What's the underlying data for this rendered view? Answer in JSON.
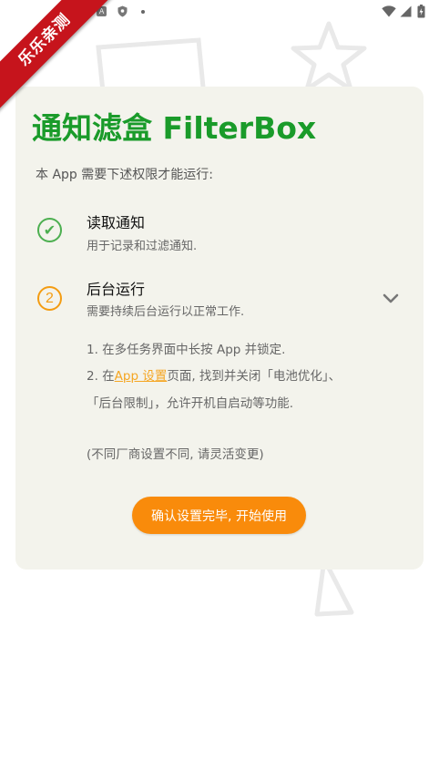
{
  "status_bar": {
    "left_icons": [
      "app-notification-icon",
      "a-notification-icon",
      "shield-notification-icon",
      "dot-notification-icon"
    ],
    "right_icons": [
      "wifi-icon",
      "signal-icon",
      "battery-icon"
    ],
    "box_letter": "A"
  },
  "ribbon": {
    "label": "乐乐亲测"
  },
  "card": {
    "title": "通知滤盒 FilterBox",
    "intro": "本 App 需要下述权限才能运行:",
    "permissions": [
      {
        "status": "granted",
        "icon": "check-icon",
        "icon_glyph": "✔",
        "title": "读取通知",
        "desc": "用于记录和过滤通知."
      },
      {
        "status": "pending",
        "icon": "step-number-icon",
        "icon_glyph": "2",
        "title": "后台运行",
        "desc": "需要持续后台运行以正常工作.",
        "expanded": true
      }
    ],
    "instructions": {
      "line1": "1. 在多任务界面中长按 App 并锁定.",
      "line2_prefix": "2. 在",
      "line2_link": "App 设置",
      "line2_suffix": "页面, 找到并关闭「电池优化」、",
      "line3": "「后台限制」，允许开机自启动等功能.",
      "note": "(不同厂商设置不同, 请灵活变更)"
    },
    "confirm_label": "确认设置完毕, 开始使用"
  },
  "colors": {
    "title_green": "#1a9b2a",
    "check_green": "#4caf50",
    "pending_orange": "#f39c12",
    "link_orange": "#f5a623",
    "button_orange": "#f98b0b",
    "card_bg": "#f3f3ec",
    "ribbon_red": "#c6141c"
  }
}
